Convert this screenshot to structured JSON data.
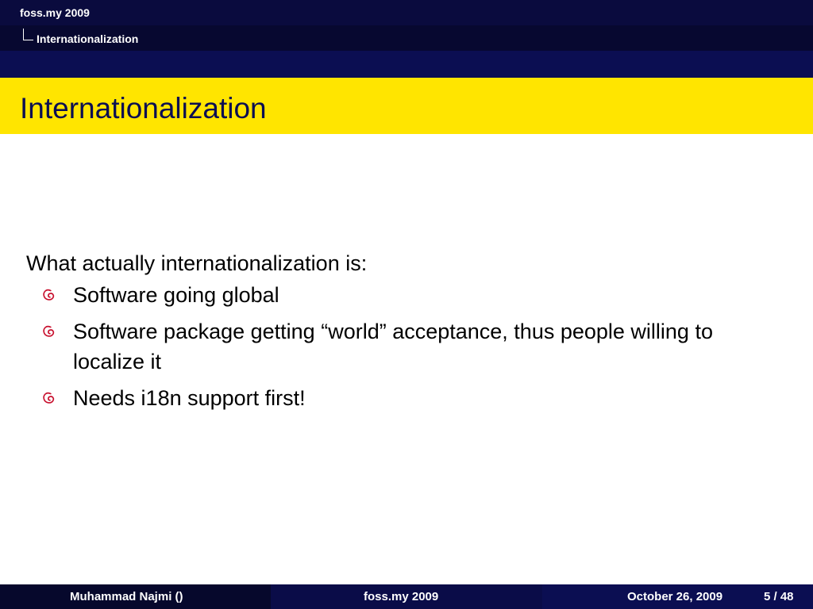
{
  "header": {
    "conference": "foss.my 2009",
    "section": "Internationalization"
  },
  "slide": {
    "title": "Internationalization",
    "intro": "What actually internationalization is:",
    "bullets": [
      {
        "text": "Software going global",
        "icon": "debian-swirl-icon"
      },
      {
        "text": "Software package getting “world” acceptance, thus people willing to localize it",
        "icon": "debian-swirl-icon"
      },
      {
        "text": "Needs i18n support first!",
        "icon": "debian-swirl-icon"
      }
    ]
  },
  "footer": {
    "author": "Muhammad Najmi  ()",
    "event": "foss.my 2009",
    "date": "October 26, 2009",
    "page": "5 / 48"
  },
  "colors": {
    "navy": "#0b0e52",
    "title_bar": "#ffe500",
    "bullet_icon": "#c8102e"
  }
}
